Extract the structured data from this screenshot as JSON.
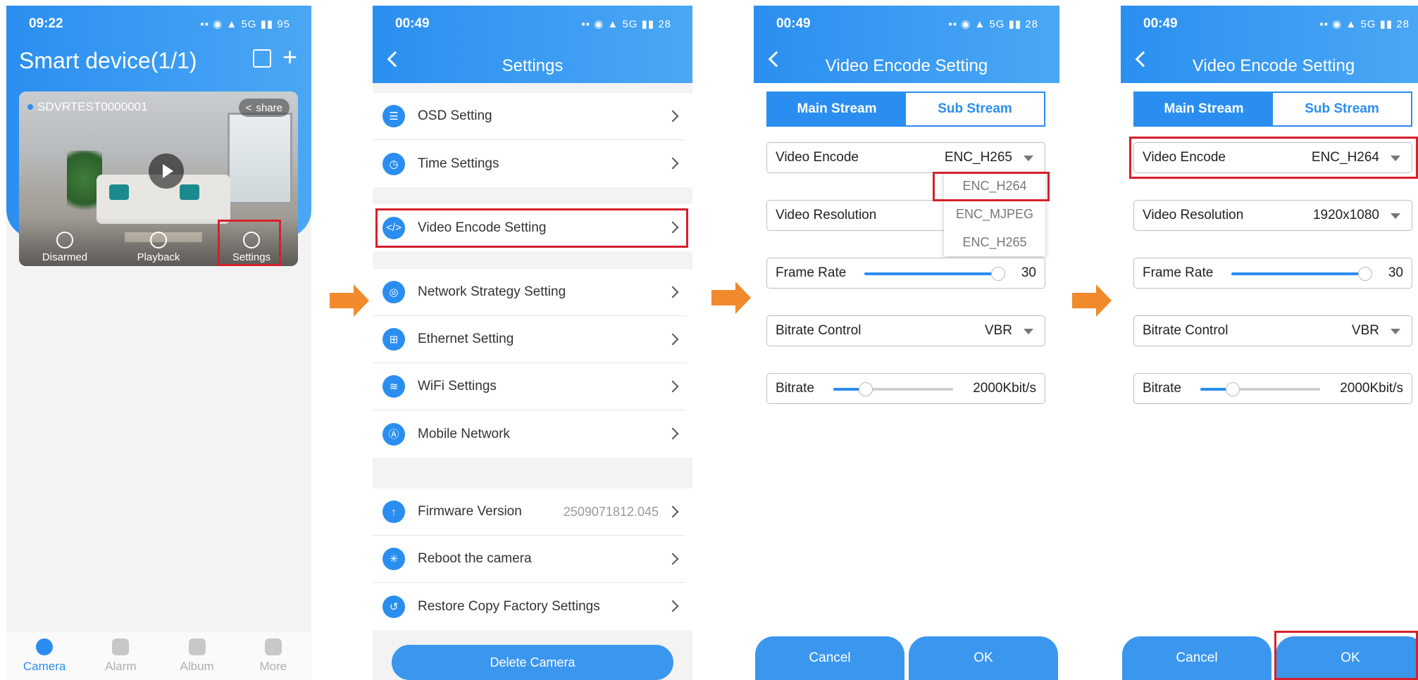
{
  "phone1": {
    "status_time": "09:22",
    "status_battery": "95",
    "title": "Smart device(1/1)",
    "camera": {
      "name": "SDVRTEST0000001",
      "share_label": "share"
    },
    "actions": [
      "Disarmed",
      "Playback",
      "Settings"
    ],
    "tabs": [
      {
        "label": "Camera",
        "icon": "camera-icon"
      },
      {
        "label": "Alarm",
        "icon": "bell-icon"
      },
      {
        "label": "Album",
        "icon": "folder-icon"
      },
      {
        "label": "More",
        "icon": "person-icon"
      }
    ]
  },
  "phone2": {
    "status_time": "00:49",
    "status_battery": "28",
    "title": "Settings",
    "items": [
      {
        "label": "OSD Setting",
        "icon": "osd-icon",
        "value": ""
      },
      {
        "label": "Time Settings",
        "icon": "clock-icon",
        "value": ""
      },
      {
        "label": "Video Encode Setting",
        "icon": "code-icon",
        "value": ""
      },
      {
        "label": "Network Strategy Setting",
        "icon": "globe-icon",
        "value": ""
      },
      {
        "label": "Ethernet Setting",
        "icon": "ethernet-icon",
        "value": ""
      },
      {
        "label": "WiFi Settings",
        "icon": "wifi-icon",
        "value": ""
      },
      {
        "label": "Mobile Network",
        "icon": "antenna-icon",
        "value": ""
      },
      {
        "label": "Firmware Version",
        "icon": "upload-icon",
        "value": "2509071812.045"
      },
      {
        "label": "Reboot the camera",
        "icon": "reboot-icon",
        "value": ""
      },
      {
        "label": "Restore Copy Factory Settings",
        "icon": "restore-icon",
        "value": ""
      }
    ],
    "delete_label": "Delete Camera"
  },
  "phone3": {
    "status_time": "00:49",
    "status_battery": "28",
    "title": "Video Encode Setting",
    "tab_main": "Main Stream",
    "tab_sub": "Sub Stream",
    "video_encode_label": "Video Encode",
    "video_encode_value": "ENC_H265",
    "video_resolution_label": "Video Resolution",
    "dropdown_options": [
      "ENC_H264",
      "ENC_MJPEG",
      "ENC_H265"
    ],
    "frame_rate_label": "Frame Rate",
    "frame_rate_value": "30",
    "frame_rate_fraction": 1.0,
    "bitrate_control_label": "Bitrate Control",
    "bitrate_control_value": "VBR",
    "bitrate_label": "Bitrate",
    "bitrate_value": "2000Kbit/s",
    "bitrate_fraction": 0.27,
    "cancel_label": "Cancel",
    "ok_label": "OK"
  },
  "phone4": {
    "status_time": "00:49",
    "status_battery": "28",
    "title": "Video Encode Setting",
    "tab_main": "Main Stream",
    "tab_sub": "Sub Stream",
    "video_encode_label": "Video Encode",
    "video_encode_value": "ENC_H264",
    "video_resolution_label": "Video Resolution",
    "video_resolution_value": "1920x1080",
    "frame_rate_label": "Frame Rate",
    "frame_rate_value": "30",
    "frame_rate_fraction": 1.0,
    "bitrate_control_label": "Bitrate Control",
    "bitrate_control_value": "VBR",
    "bitrate_label": "Bitrate",
    "bitrate_value": "2000Kbit/s",
    "bitrate_fraction": 0.27,
    "cancel_label": "Cancel",
    "ok_label": "OK"
  },
  "colors": {
    "accent": "#2a8ef0",
    "highlight": "#d6202b",
    "arrow": "#f08a2c"
  }
}
